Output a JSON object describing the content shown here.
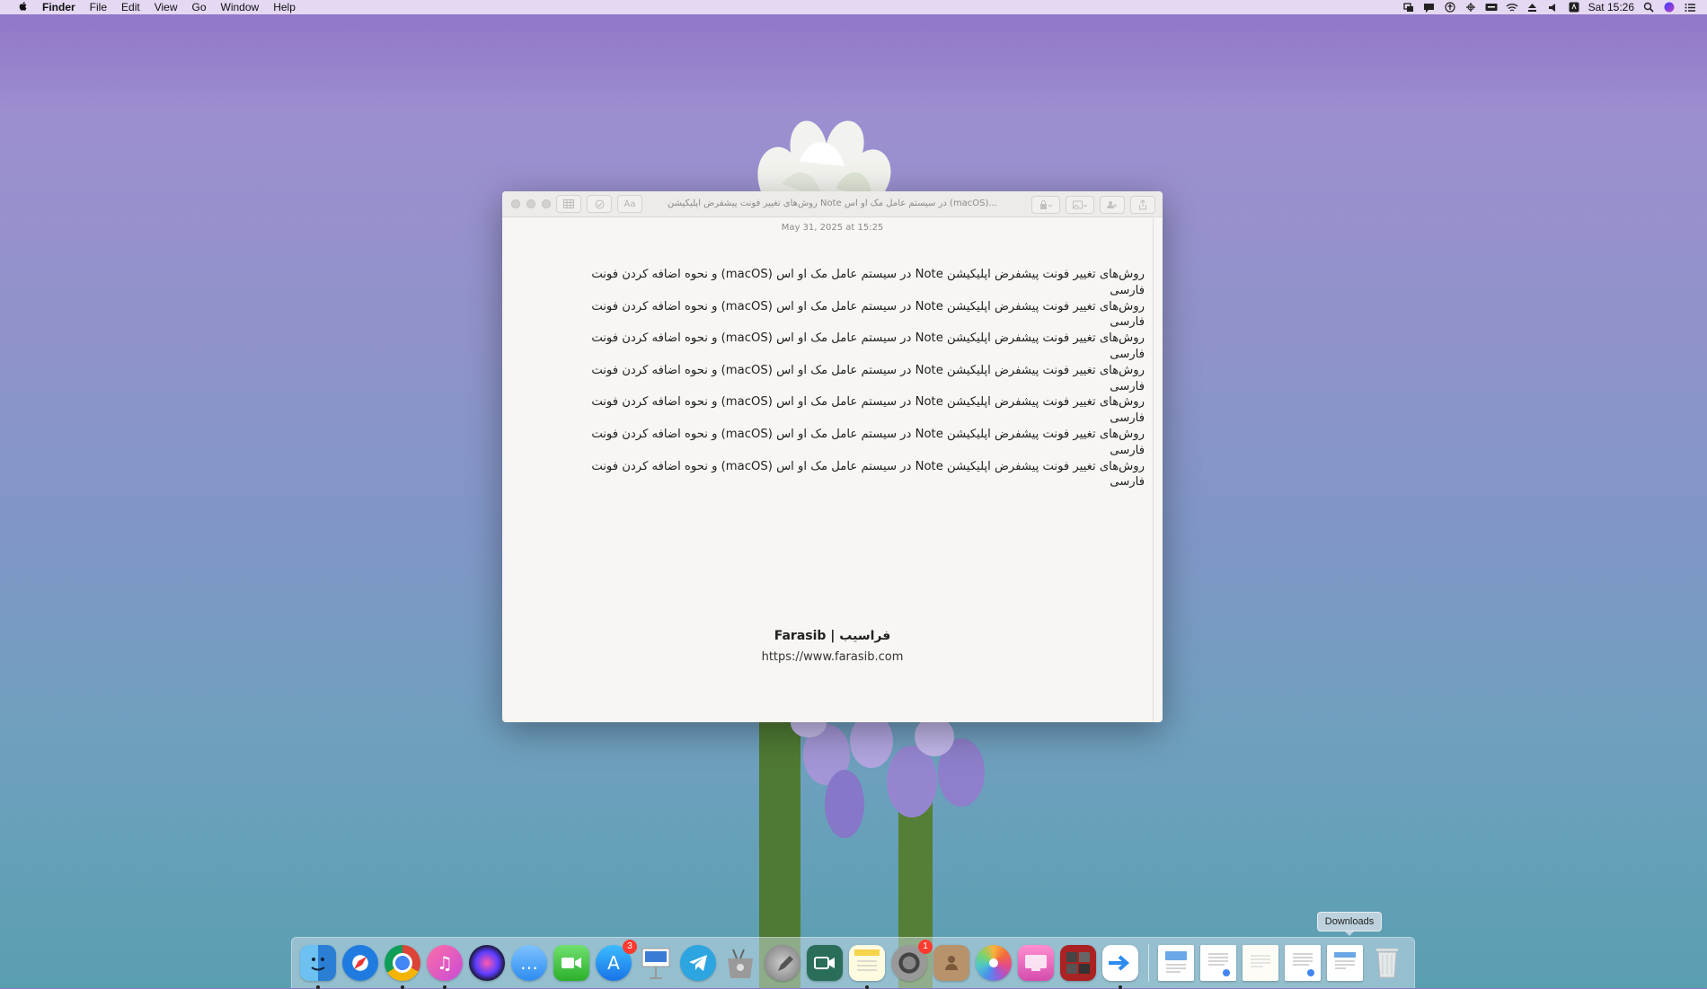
{
  "menubar": {
    "apple_icon": "apple-icon",
    "app_name": "Finder",
    "menus": [
      "File",
      "Edit",
      "View",
      "Go",
      "Window",
      "Help"
    ],
    "clock": "Sat 15:26"
  },
  "note_window": {
    "title": "روش‌های تغییر فونت پیشفرض اپلیکیشن Note در سیستم عامل مک او اس (macOS)...",
    "date": "May 31, 2025 at 15:25",
    "lines": [
      "روش‌های تغییر فونت پیشفرض اپلیکیشن Note در سیستم عامل مک او اس (macOS) و نحوه اضافه کردن فونت فارسی",
      "روش‌های تغییر فونت پیشفرض اپلیکیشن Note در سیستم عامل مک او اس (macOS) و نحوه اضافه کردن فونت فارسی",
      "روش‌های تغییر فونت پیشفرض اپلیکیشن Note در سیستم عامل مک او اس (macOS) و نحوه اضافه کردن فونت فارسی",
      "روش‌های تغییر فونت پیشفرض اپلیکیشن Note در سیستم عامل مک او اس (macOS) و نحوه اضافه کردن فونت فارسی",
      "روش‌های تغییر فونت پیشفرض اپلیکیشن Note در سیستم عامل مک او اس (macOS) و نحوه اضافه کردن فونت فارسی",
      "روش‌های تغییر فونت پیشفرض اپلیکیشن Note در سیستم عامل مک او اس (macOS) و نحوه اضافه کردن فونت فارسی",
      "روش‌های تغییر فونت پیشفرض اپلیکیشن Note در سیستم عامل مک او اس (macOS) و نحوه اضافه کردن فونت فارسی"
    ],
    "toolbar_font_label": "Aa"
  },
  "watermark": {
    "brand": "Farasib | فراسیب",
    "url": "https://www.farasib.com"
  },
  "dock": {
    "tooltip": "Downloads",
    "badges": {
      "app_store": "3",
      "system_preferences": "1"
    }
  },
  "colors": {
    "badge": "#ff3b30",
    "desktop_top": "#8f74c8",
    "desktop_bottom": "#5a9fb0"
  }
}
